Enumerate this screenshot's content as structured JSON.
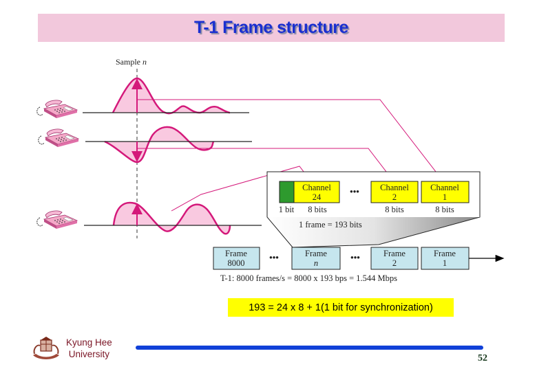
{
  "slide": {
    "title": "T-1 Frame structure",
    "page_number": "52",
    "formula": "193 = 24  x 8 + 1(1 bit for synchronization)",
    "institution": {
      "line1": "Kyung Hee",
      "line2": "University",
      "logo_icon": "university-crest-icon"
    }
  },
  "diagram": {
    "sample_label_prefix": "Sample ",
    "sample_label_var": "n",
    "telephones": [
      {
        "icon": "telephone-icon",
        "channel": "1"
      },
      {
        "icon": "telephone-icon",
        "channel": "2"
      },
      {
        "icon": "telephone-icon",
        "channel": "24"
      }
    ],
    "frame_detail": {
      "sync_bit_label": "1 bit",
      "channels": [
        {
          "line1": "Channel",
          "line2": "24",
          "bits": "8 bits"
        },
        {
          "line1": "Channel",
          "line2": "2",
          "bits": "8 bits"
        },
        {
          "line1": "Channel",
          "line2": "1",
          "bits": "8 bits"
        }
      ],
      "ellipsis": "•••",
      "frame_size_label": "1 frame = 193 bits"
    },
    "frames": [
      {
        "line1": "Frame",
        "line2": "8000"
      },
      {
        "line1": "Frame",
        "line2": "n"
      },
      {
        "line1": "Frame",
        "line2": "2"
      },
      {
        "line1": "Frame",
        "line2": "1"
      }
    ],
    "frames_ellipsis": "•••",
    "rate_label": "T-1: 8000 frames/s = 8000 x 193 bps = 1.544 Mbps"
  },
  "colors": {
    "title_bg": "#f2c8dc",
    "title_text": "#1a2fd0",
    "signal": "#d4187a",
    "signal_fill": "#f9c9e0",
    "channel_box": "#ffff00",
    "sync_bit": "#2e9a2e",
    "frame_box": "#c6e6ee",
    "formula_bg": "#ffff00",
    "rule": "#1040d8"
  }
}
